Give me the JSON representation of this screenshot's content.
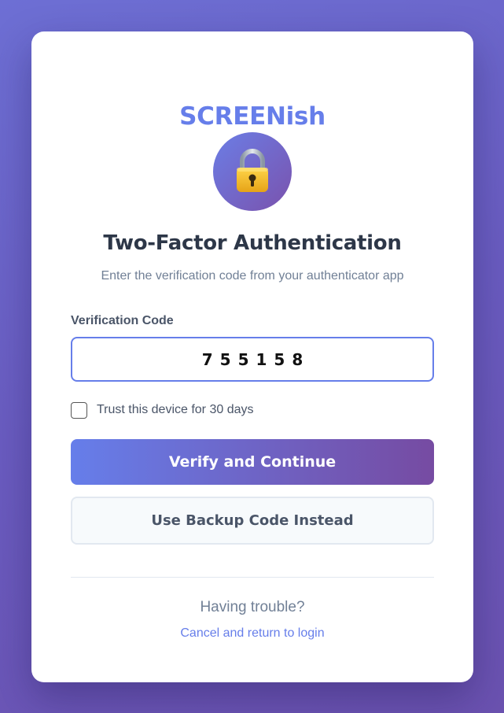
{
  "brand": {
    "name": "SCREENish",
    "color": "#667eea"
  },
  "icon": {
    "name": "lock-icon"
  },
  "header": {
    "title": "Two-Factor Authentication",
    "subtitle": "Enter the verification code from your authenticator app"
  },
  "form": {
    "code_label": "Verification Code",
    "code_value": "755158",
    "trust_label": "Trust this device for 30 days",
    "trust_checked": false
  },
  "buttons": {
    "verify_label": "Verify and Continue",
    "backup_label": "Use Backup Code Instead"
  },
  "footer": {
    "trouble_text": "Having trouble?",
    "cancel_link": "Cancel and return to login"
  },
  "colors": {
    "accent": "#667eea",
    "accent_end": "#764ba2",
    "text_dark": "#2d3748",
    "text_muted": "#718096"
  }
}
